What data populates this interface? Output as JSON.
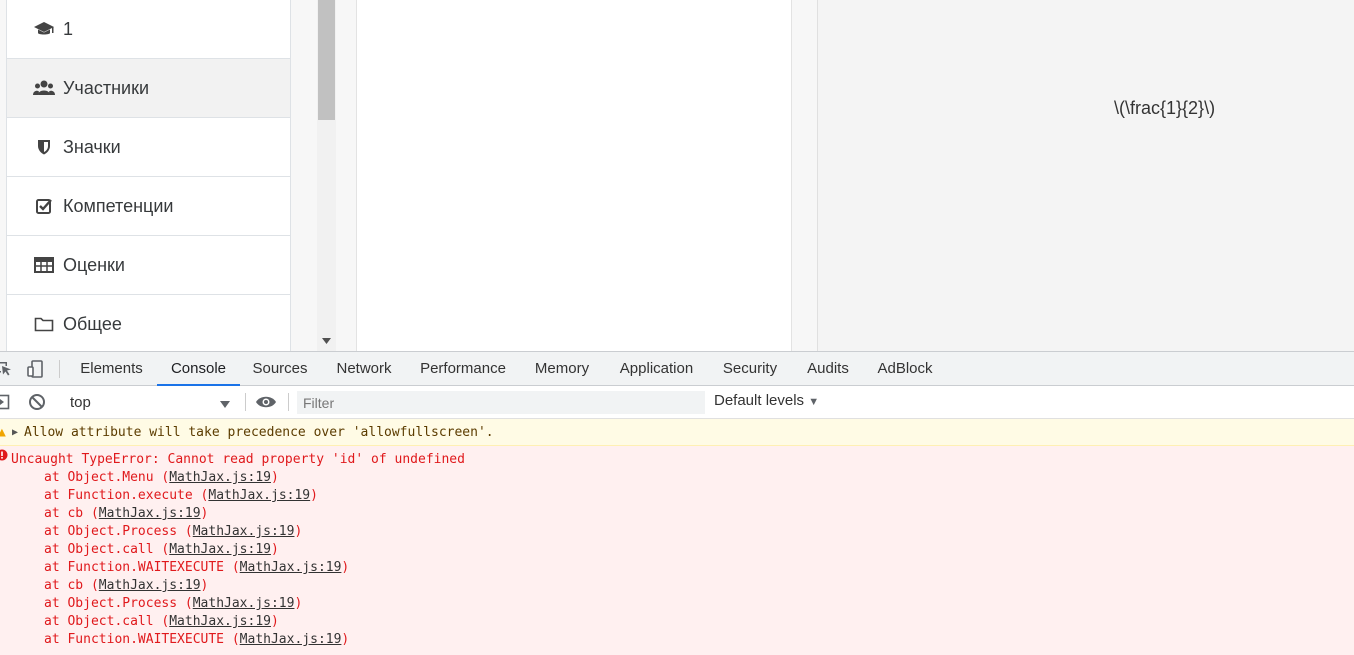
{
  "sidebar": {
    "items": [
      {
        "label": "1",
        "icon": "graduation-cap-icon"
      },
      {
        "label": "Участники",
        "icon": "users-icon"
      },
      {
        "label": "Значки",
        "icon": "shield-icon"
      },
      {
        "label": "Компетенции",
        "icon": "checkbox-icon"
      },
      {
        "label": "Оценки",
        "icon": "table-icon"
      },
      {
        "label": "Общее",
        "icon": "folder-icon"
      }
    ]
  },
  "content": {
    "math_text": "\\(\\frac{1}{2}\\)"
  },
  "devtools": {
    "tabs": [
      "Elements",
      "Console",
      "Sources",
      "Network",
      "Performance",
      "Memory",
      "Application",
      "Security",
      "Audits",
      "AdBlock"
    ],
    "active_tab": "Console",
    "toolbar": {
      "context": "top",
      "filter_placeholder": "Filter",
      "levels": "Default levels"
    },
    "console": {
      "warning": "Allow attribute will take precedence over 'allowfullscreen'.",
      "error": {
        "message": "Uncaught TypeError: Cannot read property 'id' of undefined",
        "stack": [
          {
            "fn": "at Object.Menu",
            "loc": "MathJax.js:19"
          },
          {
            "fn": "at Function.execute",
            "loc": "MathJax.js:19"
          },
          {
            "fn": "at cb",
            "loc": "MathJax.js:19"
          },
          {
            "fn": "at Object.Process",
            "loc": "MathJax.js:19"
          },
          {
            "fn": "at Object.call",
            "loc": "MathJax.js:19"
          },
          {
            "fn": "at Function.WAITEXECUTE",
            "loc": "MathJax.js:19"
          },
          {
            "fn": "at cb",
            "loc": "MathJax.js:19"
          },
          {
            "fn": "at Object.Process",
            "loc": "MathJax.js:19"
          },
          {
            "fn": "at Object.call",
            "loc": "MathJax.js:19"
          },
          {
            "fn": "at Function.WAITEXECUTE",
            "loc": "MathJax.js:19"
          }
        ]
      }
    }
  }
}
